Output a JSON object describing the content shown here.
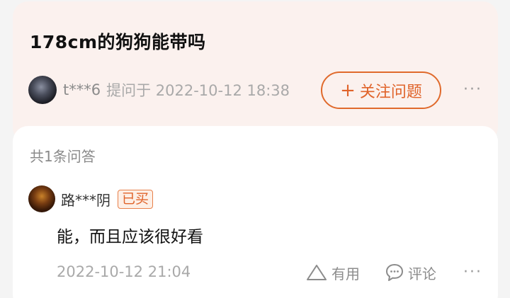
{
  "question": {
    "title": "178cm的狗狗能带吗",
    "asker": "t***6",
    "asked_at": "提问于 2022-10-12 18:38",
    "follow_button": "关注问题",
    "follow_plus": "+",
    "more": "···"
  },
  "answers": {
    "count_label": "共1条问答",
    "items": [
      {
        "user": "路***阴",
        "badge": "已买",
        "text": "能，而且应该很好看",
        "time": "2022-10-12 21:04",
        "useful_label": "有用",
        "comment_label": "评论",
        "more": "···"
      }
    ]
  },
  "colors": {
    "accent": "#e0632a",
    "question_card_bg": "#fbf1ee",
    "answer_card_bg": "#ffffff"
  },
  "icons": [
    "user-avatar",
    "triangle-useful-icon",
    "chat-bubble-icon",
    "more-dots-icon",
    "plus-icon"
  ]
}
